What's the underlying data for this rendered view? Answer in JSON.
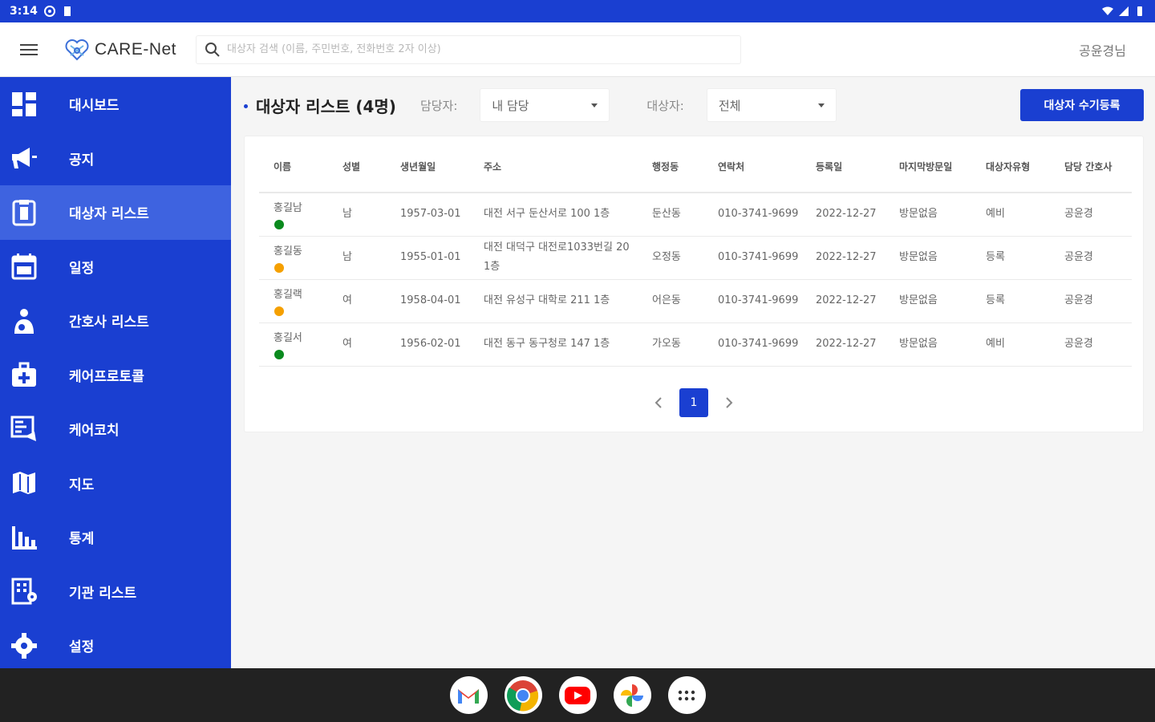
{
  "status_bar": {
    "time": "3:14"
  },
  "app": {
    "logo_text": "CARE-Net",
    "search_placeholder": "대상자 검색 (이름, 주민번호, 전화번호 2자 이상)",
    "user_name": "공윤경님"
  },
  "sidebar": {
    "items": [
      {
        "label": "대시보드",
        "icon": "dashboard-icon"
      },
      {
        "label": "공지",
        "icon": "megaphone-icon"
      },
      {
        "label": "대상자 리스트",
        "icon": "clipboard-icon",
        "active": true
      },
      {
        "label": "일정",
        "icon": "calendar-icon"
      },
      {
        "label": "간호사 리스트",
        "icon": "nurse-icon"
      },
      {
        "label": "케어프로토콜",
        "icon": "medical-kit-icon"
      },
      {
        "label": "케어코치",
        "icon": "chat-icon"
      },
      {
        "label": "지도",
        "icon": "map-icon"
      },
      {
        "label": "통계",
        "icon": "bar-chart-icon"
      },
      {
        "label": "기관 리스트",
        "icon": "building-icon"
      },
      {
        "label": "설정",
        "icon": "gear-icon"
      }
    ]
  },
  "main": {
    "title": "대상자 리스트 (4명)",
    "manager_filter": {
      "label": "담당자:",
      "value": "내 담당"
    },
    "target_filter": {
      "label": "대상자:",
      "value": "전체"
    },
    "add_button": "대상자 수기등록",
    "table": {
      "headers": [
        "이름",
        "성별",
        "생년월일",
        "주소",
        "행정동",
        "연락처",
        "등록일",
        "마지막방문일",
        "대상자유형",
        "담당 간호사"
      ],
      "rows": [
        {
          "name": "홍길남",
          "status_color": "green",
          "gender": "남",
          "birth": "1957-03-01",
          "address": "대전 서구 둔산서로 100 1층",
          "dong": "둔산동",
          "phone": "010-3741-9699",
          "registered": "2022-12-27",
          "last_visit": "방문없음",
          "type": "예비",
          "nurse": "공윤경"
        },
        {
          "name": "홍길동",
          "status_color": "orange",
          "gender": "남",
          "birth": "1955-01-01",
          "address": "대전 대덕구 대전로1033번길 20 1층",
          "dong": "오정동",
          "phone": "010-3741-9699",
          "registered": "2022-12-27",
          "last_visit": "방문없음",
          "type": "등록",
          "nurse": "공윤경"
        },
        {
          "name": "홍길랙",
          "status_color": "orange",
          "gender": "여",
          "birth": "1958-04-01",
          "address": "대전 유성구 대학로 211 1층",
          "dong": "어은동",
          "phone": "010-3741-9699",
          "registered": "2022-12-27",
          "last_visit": "방문없음",
          "type": "등록",
          "nurse": "공윤경"
        },
        {
          "name": "홍길서",
          "status_color": "green",
          "gender": "여",
          "birth": "1956-02-01",
          "address": "대전 동구 동구청로 147 1층",
          "dong": "가오동",
          "phone": "010-3741-9699",
          "registered": "2022-12-27",
          "last_visit": "방문없음",
          "type": "예비",
          "nurse": "공윤경"
        }
      ]
    },
    "pagination": {
      "current_page": "1"
    }
  },
  "dock": {
    "apps": [
      "gmail-icon",
      "chrome-icon",
      "youtube-icon",
      "photos-icon",
      "app-launcher-icon"
    ]
  },
  "colors": {
    "primary": "#1a3fd1",
    "sidebar_active": "#3e63e0",
    "status_green": "#0a8a1e",
    "status_orange": "#f5a000"
  }
}
